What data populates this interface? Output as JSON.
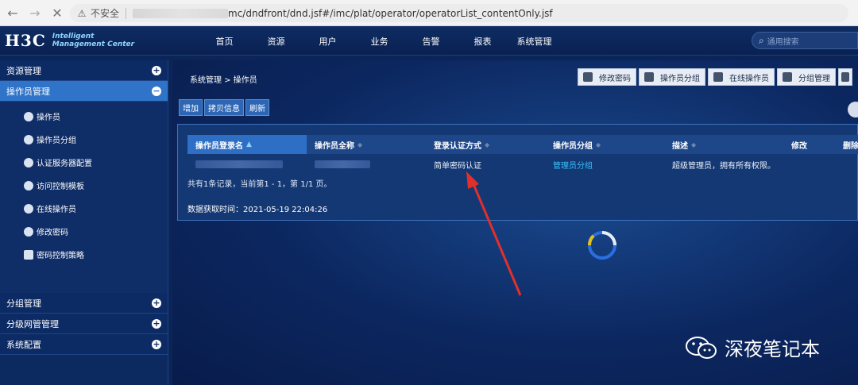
{
  "browser": {
    "back_icon": "←",
    "forward_icon": "→",
    "stop_icon": "✕",
    "security_label": "不安全",
    "url_path": "mc/dndfront/dnd.jsf#/imc/plat/operator/operatorList_contentOnly.jsf"
  },
  "header": {
    "logo": "H3C",
    "logo_sub_1": "Intelligent",
    "logo_sub_2": "Management Center",
    "menu": [
      "首页",
      "资源",
      "用户",
      "业务",
      "告警",
      "报表",
      "系统管理"
    ],
    "search_placeholder": "通用搜索"
  },
  "sidebar": {
    "sections": [
      {
        "label": "资源管理",
        "active": false
      },
      {
        "label": "操作员管理",
        "active": true
      }
    ],
    "items": [
      "操作员",
      "操作员分组",
      "认证服务器配置",
      "访问控制模板",
      "在线操作员",
      "修改密码",
      "密码控制策略"
    ],
    "bottom_sections": [
      "分组管理",
      "分级网管管理",
      "系统配置"
    ]
  },
  "main": {
    "breadcrumb": "系统管理 > 操作员",
    "tabs": [
      "修改密码",
      "操作员分组",
      "在线操作员",
      "分组管理"
    ],
    "actions": [
      "增加",
      "拷贝信息",
      "刷新"
    ],
    "table": {
      "headers": [
        "操作员登录名",
        "操作员全称",
        "登录认证方式",
        "操作员分组",
        "描述",
        "修改",
        "删除"
      ],
      "row": {
        "auth": "简单密码认证",
        "group": "管理员分组",
        "description": "超级管理员，拥有所有权限。"
      }
    },
    "summary": "共有1条记录，当前第1 - 1，第 1/1 页。",
    "fetch_time": "数据获取时间：2021-05-19 22:04:26"
  },
  "watermark": "深夜笔记本",
  "colors": {
    "accent": "#2f74c8",
    "link": "#39c4ff",
    "arrow": "#e0302c"
  }
}
